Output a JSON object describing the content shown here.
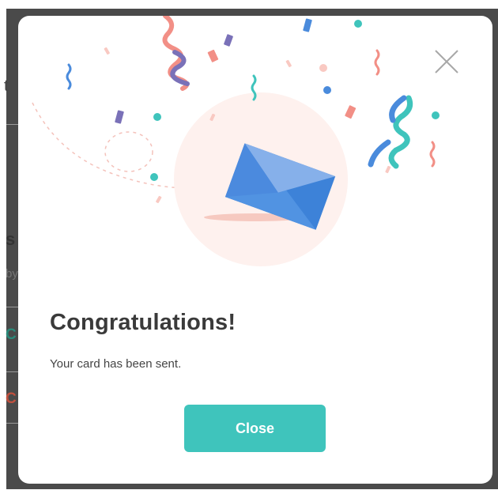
{
  "background_page": {
    "glimpses": [
      "t",
      "s",
      "by",
      "C",
      "C"
    ]
  },
  "modal": {
    "close_icon": "close-icon",
    "illustration_icon": "envelope-icon",
    "title": "Congratulations!",
    "message": "Your card has been sent.",
    "close_button_label": "Close"
  },
  "colors": {
    "overlay": "#4a4a4a",
    "accent": "#3fc4bc",
    "envelope_blue": "#3d82d8",
    "circle_bg": "#fef1ee",
    "title_text": "#3a3a3a"
  }
}
